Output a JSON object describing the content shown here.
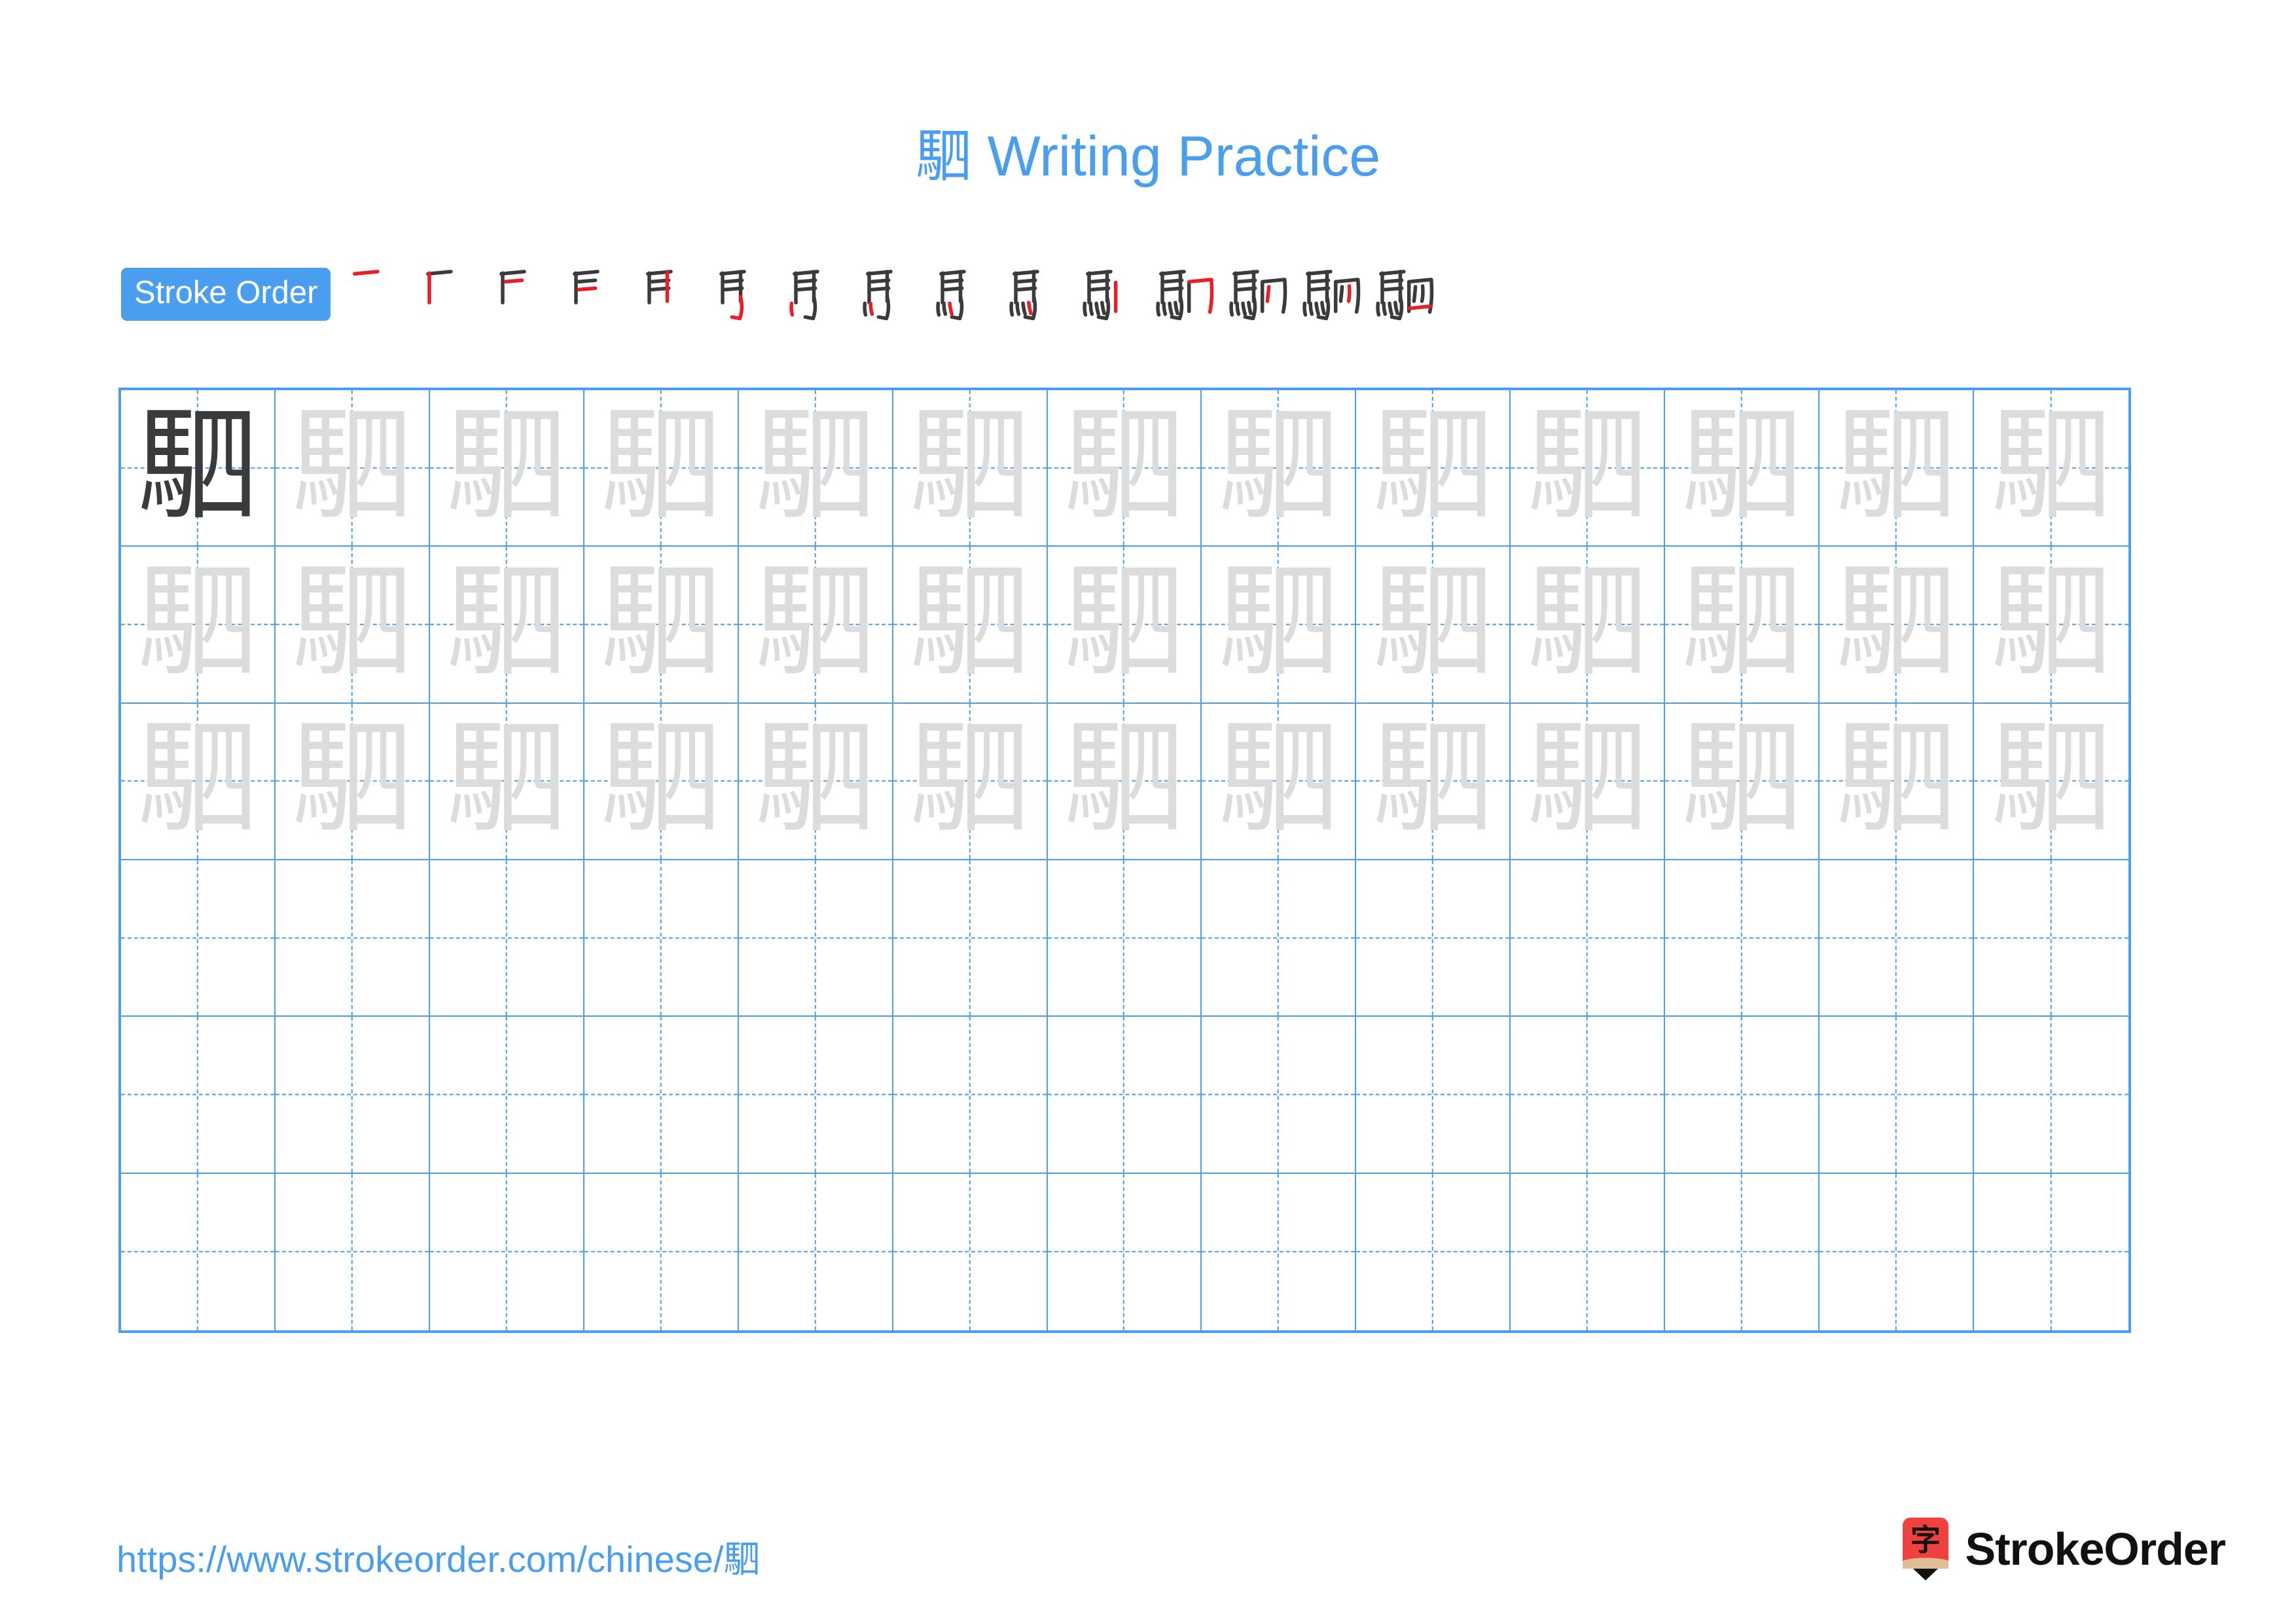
{
  "character": "駟",
  "header": {
    "title": "駟 Writing Practice",
    "title_character": "駟",
    "title_text": " Writing Practice",
    "title_color": "#4a9eef"
  },
  "stroke_order": {
    "badge_label": "Stroke Order",
    "badge_bg": "#4a9eef",
    "badge_text_color": "#ffffff",
    "total_strokes": 15,
    "new_stroke_color": "#ee1c25",
    "previous_stroke_color": "#3b3b3b",
    "steps": [
      {
        "index": 1,
        "partial": "一"
      },
      {
        "index": 2,
        "partial": "厂"
      },
      {
        "index": 3,
        "partial": "F"
      },
      {
        "index": 4,
        "partial": "手"
      },
      {
        "index": 5,
        "partial": "馬"
      },
      {
        "index": 6,
        "partial": "馬"
      },
      {
        "index": 7,
        "partial": "馬"
      },
      {
        "index": 8,
        "partial": "馬"
      },
      {
        "index": 9,
        "partial": "馬"
      },
      {
        "index": 10,
        "partial": "馬"
      },
      {
        "index": 11,
        "partial": "駟"
      },
      {
        "index": 12,
        "partial": "駟"
      },
      {
        "index": 13,
        "partial": "駟"
      },
      {
        "index": 14,
        "partial": "駟"
      },
      {
        "index": 15,
        "partial": "駟"
      }
    ]
  },
  "practice_grid": {
    "columns": 13,
    "rows": 6,
    "grid_line_color": "#4a9eef",
    "model_char_color": "#3b3b3b",
    "trace_char_color": "#dcdcdc",
    "cells": [
      [
        "model",
        "trace",
        "trace",
        "trace",
        "trace",
        "trace",
        "trace",
        "trace",
        "trace",
        "trace",
        "trace",
        "trace",
        "trace"
      ],
      [
        "trace",
        "trace",
        "trace",
        "trace",
        "trace",
        "trace",
        "trace",
        "trace",
        "trace",
        "trace",
        "trace",
        "trace",
        "trace"
      ],
      [
        "trace",
        "trace",
        "trace",
        "trace",
        "trace",
        "trace",
        "trace",
        "trace",
        "trace",
        "trace",
        "trace",
        "trace",
        "trace"
      ],
      [
        "empty",
        "empty",
        "empty",
        "empty",
        "empty",
        "empty",
        "empty",
        "empty",
        "empty",
        "empty",
        "empty",
        "empty",
        "empty"
      ],
      [
        "empty",
        "empty",
        "empty",
        "empty",
        "empty",
        "empty",
        "empty",
        "empty",
        "empty",
        "empty",
        "empty",
        "empty",
        "empty"
      ],
      [
        "empty",
        "empty",
        "empty",
        "empty",
        "empty",
        "empty",
        "empty",
        "empty",
        "empty",
        "empty",
        "empty",
        "empty",
        "empty"
      ]
    ]
  },
  "footer": {
    "url_prefix": "https://www.strokeorder.com/chinese/",
    "url_character": "駟",
    "url_color": "#4a9eef",
    "brand_name": "StrokeOrder",
    "brand_logo_char": "字",
    "brand_logo_bg": "#f0413f",
    "brand_logo_tip": "#e0bd96"
  }
}
